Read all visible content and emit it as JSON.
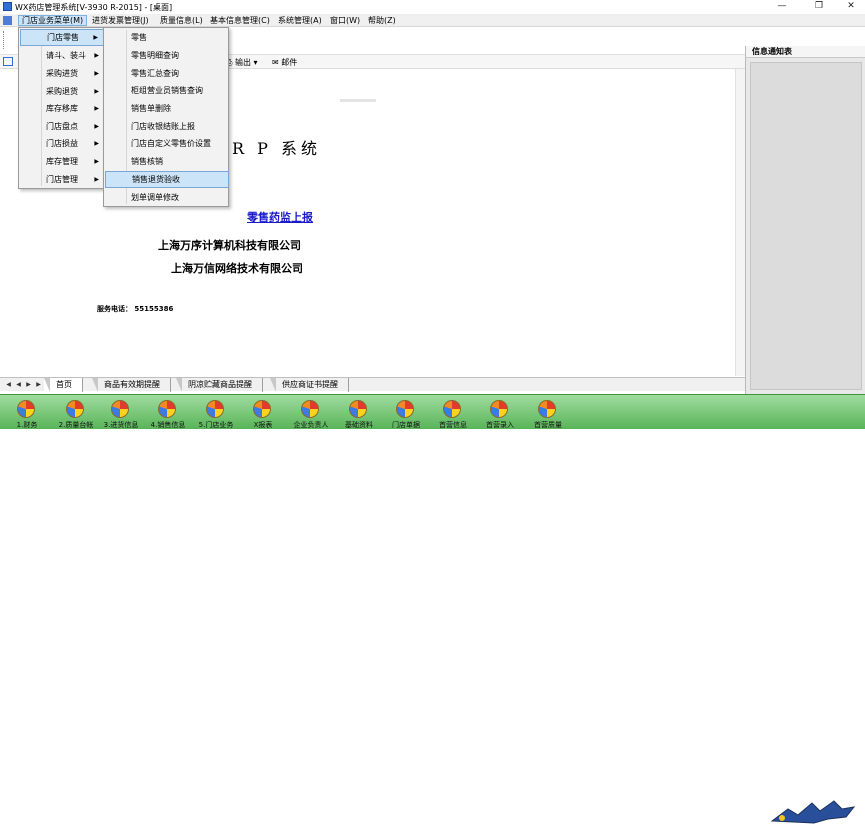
{
  "window": {
    "title": "WX药店管理系统[V-3930 R-2015] - [桌面]",
    "controls": [
      "—",
      "❐",
      "✕"
    ]
  },
  "menubar": {
    "items": [
      {
        "label": "门店业务菜单(M)",
        "active": true
      },
      {
        "label": "进货发票管理(J)"
      },
      {
        "label": "质量信息(L)"
      },
      {
        "label": "基本信息管理(C)"
      },
      {
        "label": "系统管理(A)"
      },
      {
        "label": "窗口(W)"
      },
      {
        "label": "帮助(Z)"
      }
    ]
  },
  "doc_toolbar": {
    "print_label": "输出",
    "mail_label": "邮件"
  },
  "main_menu": {
    "items": [
      {
        "label": "门店零售",
        "highlighted": true
      },
      {
        "label": "请斗、装斗"
      },
      {
        "label": "采购进货"
      },
      {
        "label": "采购退货"
      },
      {
        "label": "库存移库"
      },
      {
        "label": "门店盘点"
      },
      {
        "label": "门店损益"
      },
      {
        "label": "库存管理"
      },
      {
        "label": "门店管理"
      }
    ]
  },
  "sub_menu": {
    "items": [
      {
        "label": "零售"
      },
      {
        "label": "零售明细查询"
      },
      {
        "label": "零售汇总查询"
      },
      {
        "label": "柜组营业员销售查询"
      },
      {
        "label": "销售单删除"
      },
      {
        "label": "门店收银结账上报"
      },
      {
        "label": "门店自定义零售价设置"
      },
      {
        "label": "销售核销"
      },
      {
        "label": "销售退货验收",
        "highlighted": true
      },
      {
        "label": "划单调单修改"
      }
    ]
  },
  "content": {
    "title_fragment": "R P 系统",
    "report_link": "零售药监上报",
    "company1": "上海万序计算机科技有限公司",
    "company2": "上海万信网络技术有限公司",
    "phone": "服务电话：  55155386"
  },
  "right_panel": {
    "header": "信息通知表"
  },
  "tabs": [
    {
      "label": "首页",
      "selected": true
    },
    {
      "label": "商品有效期提醒"
    },
    {
      "label": "阴凉贮藏商品提醒"
    },
    {
      "label": "供应商证书提醒"
    }
  ],
  "bottom_bar": [
    {
      "label": "1.财务"
    },
    {
      "label": "2.质量台帐"
    },
    {
      "label": "3.进货信息"
    },
    {
      "label": "4.销售信息"
    },
    {
      "label": "5.门店业务"
    },
    {
      "label": "X报表"
    },
    {
      "label": "企业负责人"
    },
    {
      "label": "基础资料"
    },
    {
      "label": "门店单据"
    },
    {
      "label": "首营信息"
    },
    {
      "label": "首营录入"
    },
    {
      "label": "首营质量"
    }
  ]
}
